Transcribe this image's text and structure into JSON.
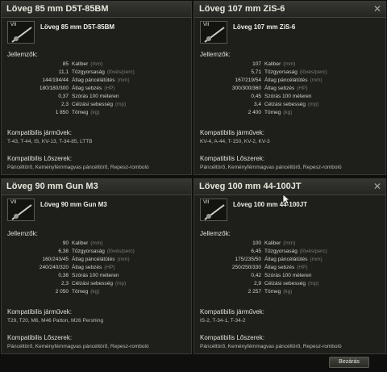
{
  "panels": [
    {
      "title": "Löveg 85 mm D5T-85BM",
      "tier": "VII",
      "gun_name": "Löveg 85 mm D5T-85BM",
      "characteristics_label": "Jellemzők:",
      "stats": [
        {
          "value": "85",
          "label": "Kaliber",
          "unit": "(mm)"
        },
        {
          "value": "11,1",
          "label": "Tűzgyorsaság",
          "unit": "(lövés/perc)"
        },
        {
          "value": "144/194/44",
          "label": "Átlag páncélátütés",
          "unit": "(mm)"
        },
        {
          "value": "180/180/300",
          "label": "Átlag sebzés",
          "unit": "(HP)"
        },
        {
          "value": "0,37",
          "label": "Szórás 100 méteren",
          "unit": ""
        },
        {
          "value": "2,3",
          "label": "Célzási sebesség",
          "unit": "(mp)"
        },
        {
          "value": "1 850",
          "label": "Tömeg",
          "unit": "(kg)"
        }
      ],
      "vehicles_label": "Kompatibilis járművek:",
      "vehicles": "T-43, T-44, IS, KV-13, T-34-85, LTTB",
      "shells_label": "Kompatibilis Lőszerek:",
      "shells": "Páncéltörő, Keményfémmagvas páncéltörő, Repesz-romboló"
    },
    {
      "title": "Löveg 107 mm ZiS-6",
      "tier": "VII",
      "gun_name": "Löveg 107 mm ZiS-6",
      "characteristics_label": "Jellemzők:",
      "stats": [
        {
          "value": "107",
          "label": "Kaliber",
          "unit": "(mm)"
        },
        {
          "value": "5,71",
          "label": "Tűzgyorsaság",
          "unit": "(lövés/perc)"
        },
        {
          "value": "167/219/54",
          "label": "Átlag páncélátütés",
          "unit": "(mm)"
        },
        {
          "value": "300/300/360",
          "label": "Átlag sebzés",
          "unit": "(HP)"
        },
        {
          "value": "0,45",
          "label": "Szórás 100 méteren",
          "unit": ""
        },
        {
          "value": "3,4",
          "label": "Célzási sebesség",
          "unit": "(mp)"
        },
        {
          "value": "2 400",
          "label": "Tömeg",
          "unit": "(kg)"
        }
      ],
      "vehicles_label": "Kompatibilis járművek:",
      "vehicles": "KV-4, A-44, T-150, KV-2, KV-3",
      "shells_label": "Kompatibilis Lőszerek:",
      "shells": "Páncéltörő, Keményfémmagvas páncéltörő, Repesz-romboló"
    },
    {
      "title": "Löveg 90 mm Gun M3",
      "tier": "VII",
      "gun_name": "Löveg 90 mm Gun M3",
      "characteristics_label": "Jellemzők:",
      "stats": [
        {
          "value": "90",
          "label": "Kaliber",
          "unit": "(mm)"
        },
        {
          "value": "6,38",
          "label": "Tűzgyorsaság",
          "unit": "(lövés/perc)"
        },
        {
          "value": "160/243/45",
          "label": "Átlag páncélátütés",
          "unit": "(mm)"
        },
        {
          "value": "240/240/320",
          "label": "Átlag sebzés",
          "unit": "(HP)"
        },
        {
          "value": "0,38",
          "label": "Szórás 100 méteren",
          "unit": ""
        },
        {
          "value": "2,3",
          "label": "Célzási sebesség",
          "unit": "(mp)"
        },
        {
          "value": "2 050",
          "label": "Tömeg",
          "unit": "(kg)"
        }
      ],
      "vehicles_label": "Kompatibilis járművek:",
      "vehicles": "T29, T20, M6, M46 Patton, M26 Pershing",
      "shells_label": "Kompatibilis Lőszerek:",
      "shells": "Páncéltörő, Keményfémmagvas páncéltörő, Repesz-romboló"
    },
    {
      "title": "Löveg 100 mm 44-100JT",
      "tier": "VII",
      "gun_name": "Löveg 100 mm 44-100JT",
      "characteristics_label": "Jellemzők:",
      "stats": [
        {
          "value": "100",
          "label": "Kaliber",
          "unit": "(mm)"
        },
        {
          "value": "6,45",
          "label": "Tűzgyorsaság",
          "unit": "(lövés/perc)"
        },
        {
          "value": "175/235/50",
          "label": "Átlag páncélátütés",
          "unit": "(mm)"
        },
        {
          "value": "250/250/330",
          "label": "Átlag sebzés",
          "unit": "(HP)"
        },
        {
          "value": "0,42",
          "label": "Szórás 100 méteren",
          "unit": ""
        },
        {
          "value": "2,9",
          "label": "Célzási sebesség",
          "unit": "(mp)"
        },
        {
          "value": "2 257",
          "label": "Tömeg",
          "unit": "(kg)"
        }
      ],
      "vehicles_label": "Kompatibilis járművek:",
      "vehicles": "IS-2, T-34-1, T-34-2",
      "shells_label": "Kompatibilis Lőszerek:",
      "shells": "Páncéltörő, Keményfémmagvas páncéltörő, Repesz-romboló"
    }
  ],
  "close_button_label": "Bezárás",
  "close_icon": "✕"
}
